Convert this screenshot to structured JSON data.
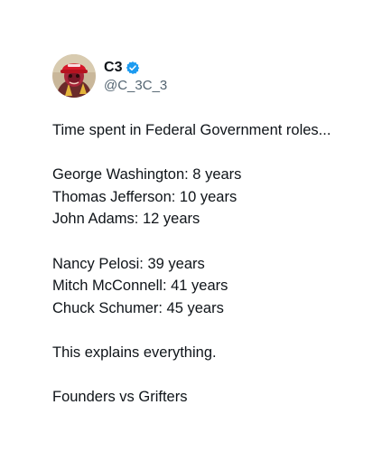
{
  "author": {
    "display_name": "C3",
    "handle": "@C_3C_3",
    "verified": true,
    "avatar_icon": "avatar-red-hat-profile",
    "verified_color": "#1d9bf0"
  },
  "tweet": {
    "intro": "Time spent in Federal Government roles...",
    "founders": [
      "George Washington: 8 years",
      "Thomas Jefferson: 10 years",
      "John Adams: 12 years"
    ],
    "politicians": [
      "Nancy Pelosi: 39 years",
      "Mitch McConnell: 41 years",
      "Chuck Schumer: 45 years"
    ],
    "conclusion": "This explains everything.",
    "closing": "Founders vs Grifters"
  }
}
